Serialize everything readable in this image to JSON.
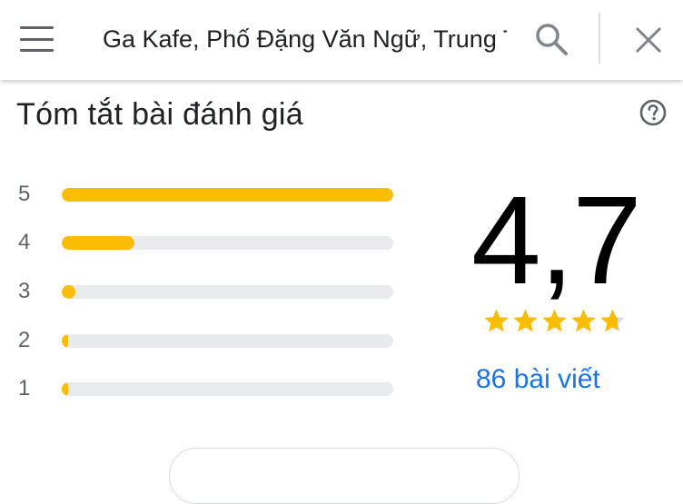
{
  "search": {
    "query": "Ga Kafe, Phố Đặng Văn Ngữ, Trung Tự, Đống Đa, Hà Nội"
  },
  "icons": {
    "menu": "hamburger-menu-icon",
    "search": "search-icon",
    "close": "close-icon",
    "help": "help-circle-icon",
    "star": "star-icon"
  },
  "summary": {
    "title": "Tóm tắt bài đánh giá",
    "average": "4,7",
    "average_value": 4.7,
    "max_stars": 5,
    "reviews_label": "86 bài viết",
    "breakdown": [
      {
        "label": "5",
        "fraction": 1.0
      },
      {
        "label": "4",
        "fraction": 0.22
      },
      {
        "label": "3",
        "fraction": 0.04
      },
      {
        "label": "2",
        "fraction": 0.02
      },
      {
        "label": "1",
        "fraction": 0.02
      }
    ]
  },
  "colors": {
    "bar_fill": "#fbbc04",
    "bar_track": "#e8eaed",
    "star_filled": "#fbbc04",
    "star_empty": "#dadce0",
    "link": "#1a73e8"
  }
}
